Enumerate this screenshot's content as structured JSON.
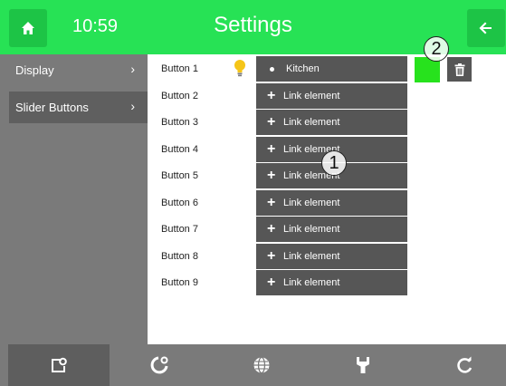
{
  "header": {
    "time": "10:59",
    "title": "Settings",
    "home_icon": "home-icon",
    "back_icon": "arrow-left-icon"
  },
  "sidebar": {
    "items": [
      {
        "label": "Display",
        "active": false
      },
      {
        "label": "Slider Buttons",
        "active": true
      }
    ]
  },
  "buttons": [
    {
      "label": "Button 1",
      "element": "Kitchen",
      "linked": true
    },
    {
      "label": "Button 2",
      "element": "Link element",
      "linked": false
    },
    {
      "label": "Button 3",
      "element": "Link element",
      "linked": false
    },
    {
      "label": "Button 4",
      "element": "Link element",
      "linked": false
    },
    {
      "label": "Button 5",
      "element": "Link element",
      "linked": false
    },
    {
      "label": "Button 6",
      "element": "Link element",
      "linked": false
    },
    {
      "label": "Button 7",
      "element": "Link element",
      "linked": false
    },
    {
      "label": "Button 8",
      "element": "Link element",
      "linked": false
    },
    {
      "label": "Button 9",
      "element": "Link element",
      "linked": false
    }
  ],
  "button1_extras": {
    "icon": "lightbulb-icon",
    "color": "#27e21d",
    "delete_icon": "trash-icon"
  },
  "callouts": [
    "1",
    "2"
  ],
  "footer": {
    "tabs": [
      {
        "icon": "room-settings-icon",
        "active": true
      },
      {
        "icon": "system-settings-icon",
        "active": false
      },
      {
        "icon": "globe-icon",
        "active": false
      },
      {
        "icon": "wrench-icon",
        "active": false
      },
      {
        "icon": "refresh-icon",
        "active": false
      }
    ]
  },
  "colors": {
    "accent": "#27e255",
    "sidebar": "#7a7a7a",
    "button": "#565656"
  }
}
